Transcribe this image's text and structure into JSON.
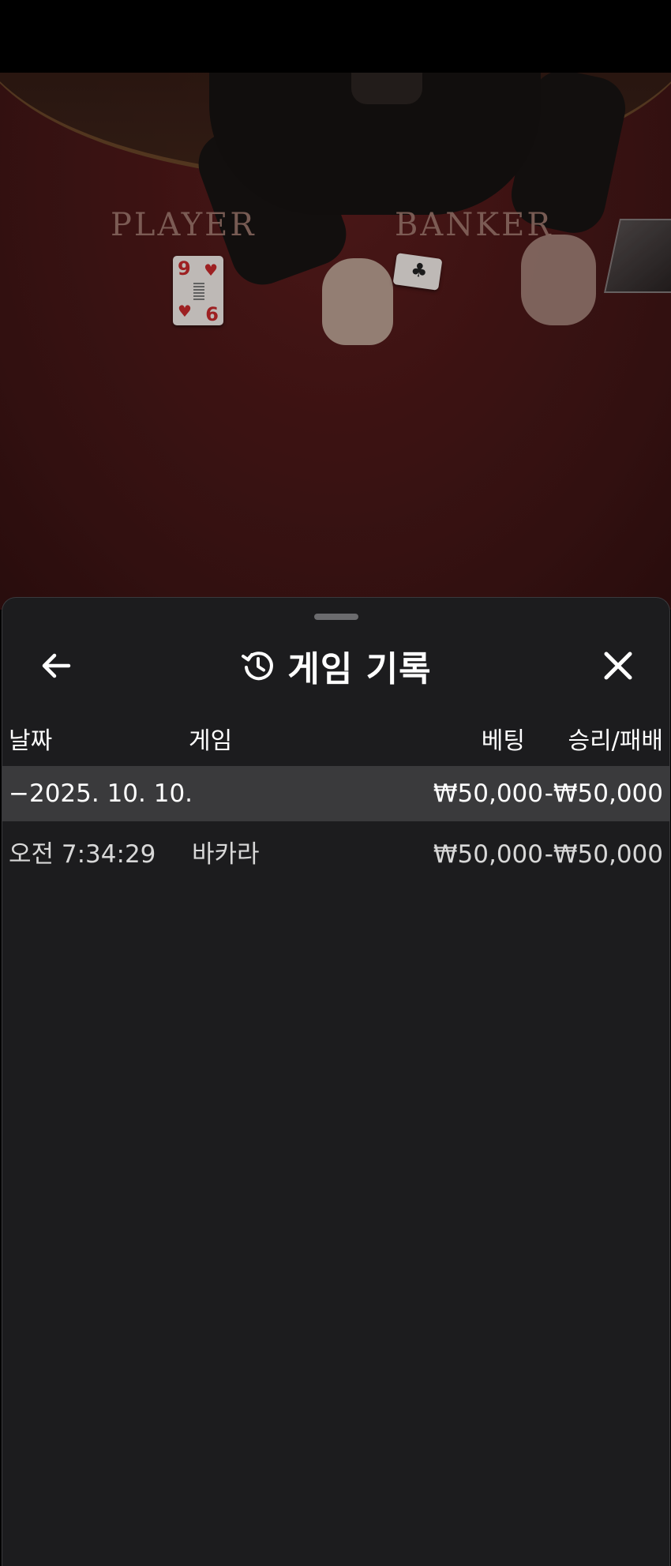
{
  "video": {
    "table_labels": {
      "player": "PLAYER",
      "banker": "BANKER"
    },
    "player_card": {
      "rank_top": "9",
      "rank_bottom": "6",
      "suit": "♥"
    },
    "banker_card": {
      "suit": "♣"
    }
  },
  "sheet": {
    "title": "게임 기록",
    "icons": {
      "back": "arrow-left-icon",
      "history": "history-icon",
      "close": "close-icon"
    }
  },
  "table": {
    "headers": {
      "date": "날짜",
      "game": "게임",
      "bet": "베팅",
      "result": "승리/패배"
    },
    "group_row": {
      "date": "−2025. 10. 10.",
      "bet": "₩50,000",
      "result": "-₩50,000"
    },
    "rows": [
      {
        "time": "오전 7:34:29",
        "game": "바카라",
        "bet": "₩50,000",
        "result": "-₩50,000"
      }
    ]
  },
  "colors": {
    "sheet_bg": "#1c1c1e",
    "group_row_bg": "#3a3a3c",
    "felt": "#4a1717",
    "text_primary": "#ffffff",
    "text_secondary": "#d8d8d8"
  }
}
